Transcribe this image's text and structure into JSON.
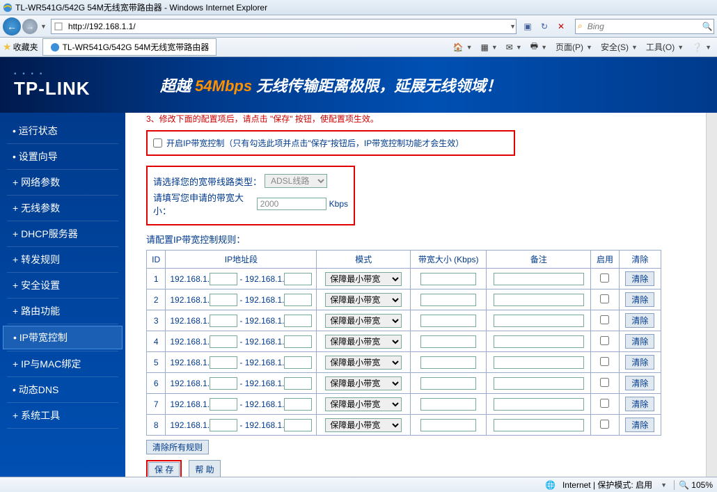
{
  "window": {
    "title": "TL-WR541G/542G 54M无线宽带路由器 - Windows Internet Explorer",
    "url": "http://192.168.1.1/",
    "search_placeholder": "Bing",
    "favorites_label": "收藏夹",
    "tab_title": "TL-WR541G/542G 54M无线宽带路由器"
  },
  "cmdbar": {
    "page": "页面(P)",
    "safety": "安全(S)",
    "tools": "工具(O)"
  },
  "banner": {
    "brand": "TP-LINK",
    "slogan_prefix": "超越",
    "slogan_speed": "54Mbps",
    "slogan_rest": "无线传输距离极限，延展无线领域！"
  },
  "sidebar": {
    "items": [
      {
        "label": "运行状态",
        "prefix": "•"
      },
      {
        "label": "设置向导",
        "prefix": "•"
      },
      {
        "label": "网络参数",
        "prefix": "+"
      },
      {
        "label": "无线参数",
        "prefix": "+"
      },
      {
        "label": "DHCP服务器",
        "prefix": "+"
      },
      {
        "label": "转发规则",
        "prefix": "+"
      },
      {
        "label": "安全设置",
        "prefix": "+"
      },
      {
        "label": "路由功能",
        "prefix": "+"
      },
      {
        "label": "IP带宽控制",
        "prefix": "•",
        "active": true
      },
      {
        "label": "IP与MAC绑定",
        "prefix": "+"
      },
      {
        "label": "动态DNS",
        "prefix": "•"
      },
      {
        "label": "系统工具",
        "prefix": "+"
      }
    ]
  },
  "content": {
    "top_notice": "3、修改下面的配置项后，请点击 \"保存\" 按钮，使配置项生效。",
    "enable_label": "开启IP带宽控制（只有勾选此项并点击\"保存\"按钮后，IP带宽控制功能才会生效）",
    "line_type_label": "请选择您的宽带线路类型：",
    "line_type_value": "ADSL线路",
    "bandwidth_label": "请填写您申请的带宽大小：",
    "bandwidth_value": "2000",
    "bandwidth_unit": "Kbps",
    "rules_title": "请配置IP带宽控制规则：",
    "headers": {
      "id": "ID",
      "ip_range": "IP地址段",
      "mode": "模式",
      "bandwidth": "带宽大小 (Kbps)",
      "remark": "备注",
      "enable": "启用",
      "clear": "清除"
    },
    "ip_prefix": "192.168.1.",
    "ip_sep": " - ",
    "mode_option": "保障最小带宽",
    "clear_btn": "清除",
    "row_ids": [
      "1",
      "2",
      "3",
      "4",
      "5",
      "6",
      "7",
      "8"
    ],
    "clear_all": "清除所有规则",
    "save": "保 存",
    "help": "帮 助"
  },
  "statusbar": {
    "zone": "Internet | 保护模式: 启用",
    "zoom": "105%"
  }
}
